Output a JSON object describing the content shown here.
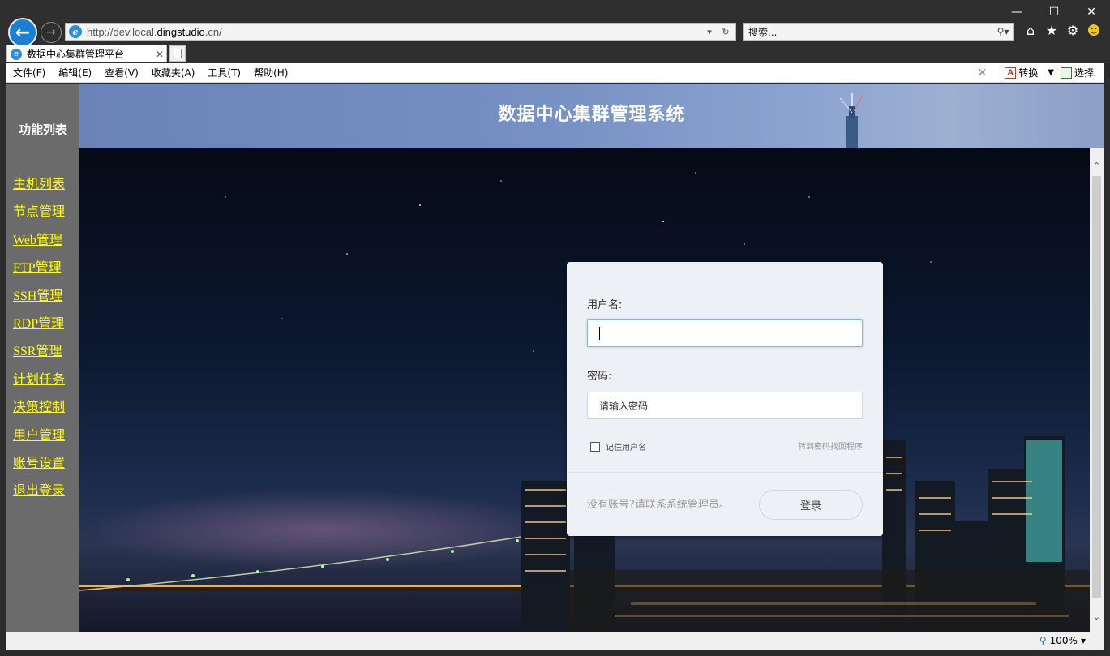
{
  "browser": {
    "url_prefix": "http://dev.local.",
    "url_host": "dingstudio",
    "url_suffix": ".cn/",
    "search_placeholder": "搜索...",
    "tab_title": "数据中心集群管理平台",
    "zoom": "100%",
    "window_controls": [
      "minimize-icon",
      "maximize-icon",
      "close-icon"
    ]
  },
  "menubar": {
    "items": [
      "文件(F)",
      "编辑(E)",
      "查看(V)",
      "收藏夹(A)",
      "工具(T)",
      "帮助(H)"
    ],
    "convert_label": "转换",
    "select_label": "选择"
  },
  "sidebar": {
    "title": "功能列表",
    "items": [
      "主机列表",
      "节点管理",
      "Web管理",
      "FTP管理",
      "SSH管理",
      "RDP管理",
      "SSR管理",
      "计划任务",
      "决策控制",
      "用户管理",
      "账号设置",
      "退出登录"
    ]
  },
  "header": {
    "title": "数据中心集群管理系统"
  },
  "login": {
    "username_label": "用户名:",
    "username_value": "",
    "password_label": "密码:",
    "password_placeholder": "请输入密码",
    "remember_label": "记住用户名",
    "forgot_link": "转到密码找回程序",
    "no_account_text": "没有账号?请联系系统管理员。",
    "login_button": "登录"
  },
  "colors": {
    "sidebar_bg": "#6b6b6b",
    "sidebar_link": "#ffff00",
    "header_bg": "#7690c4",
    "card_bg": "#edf1f5"
  }
}
